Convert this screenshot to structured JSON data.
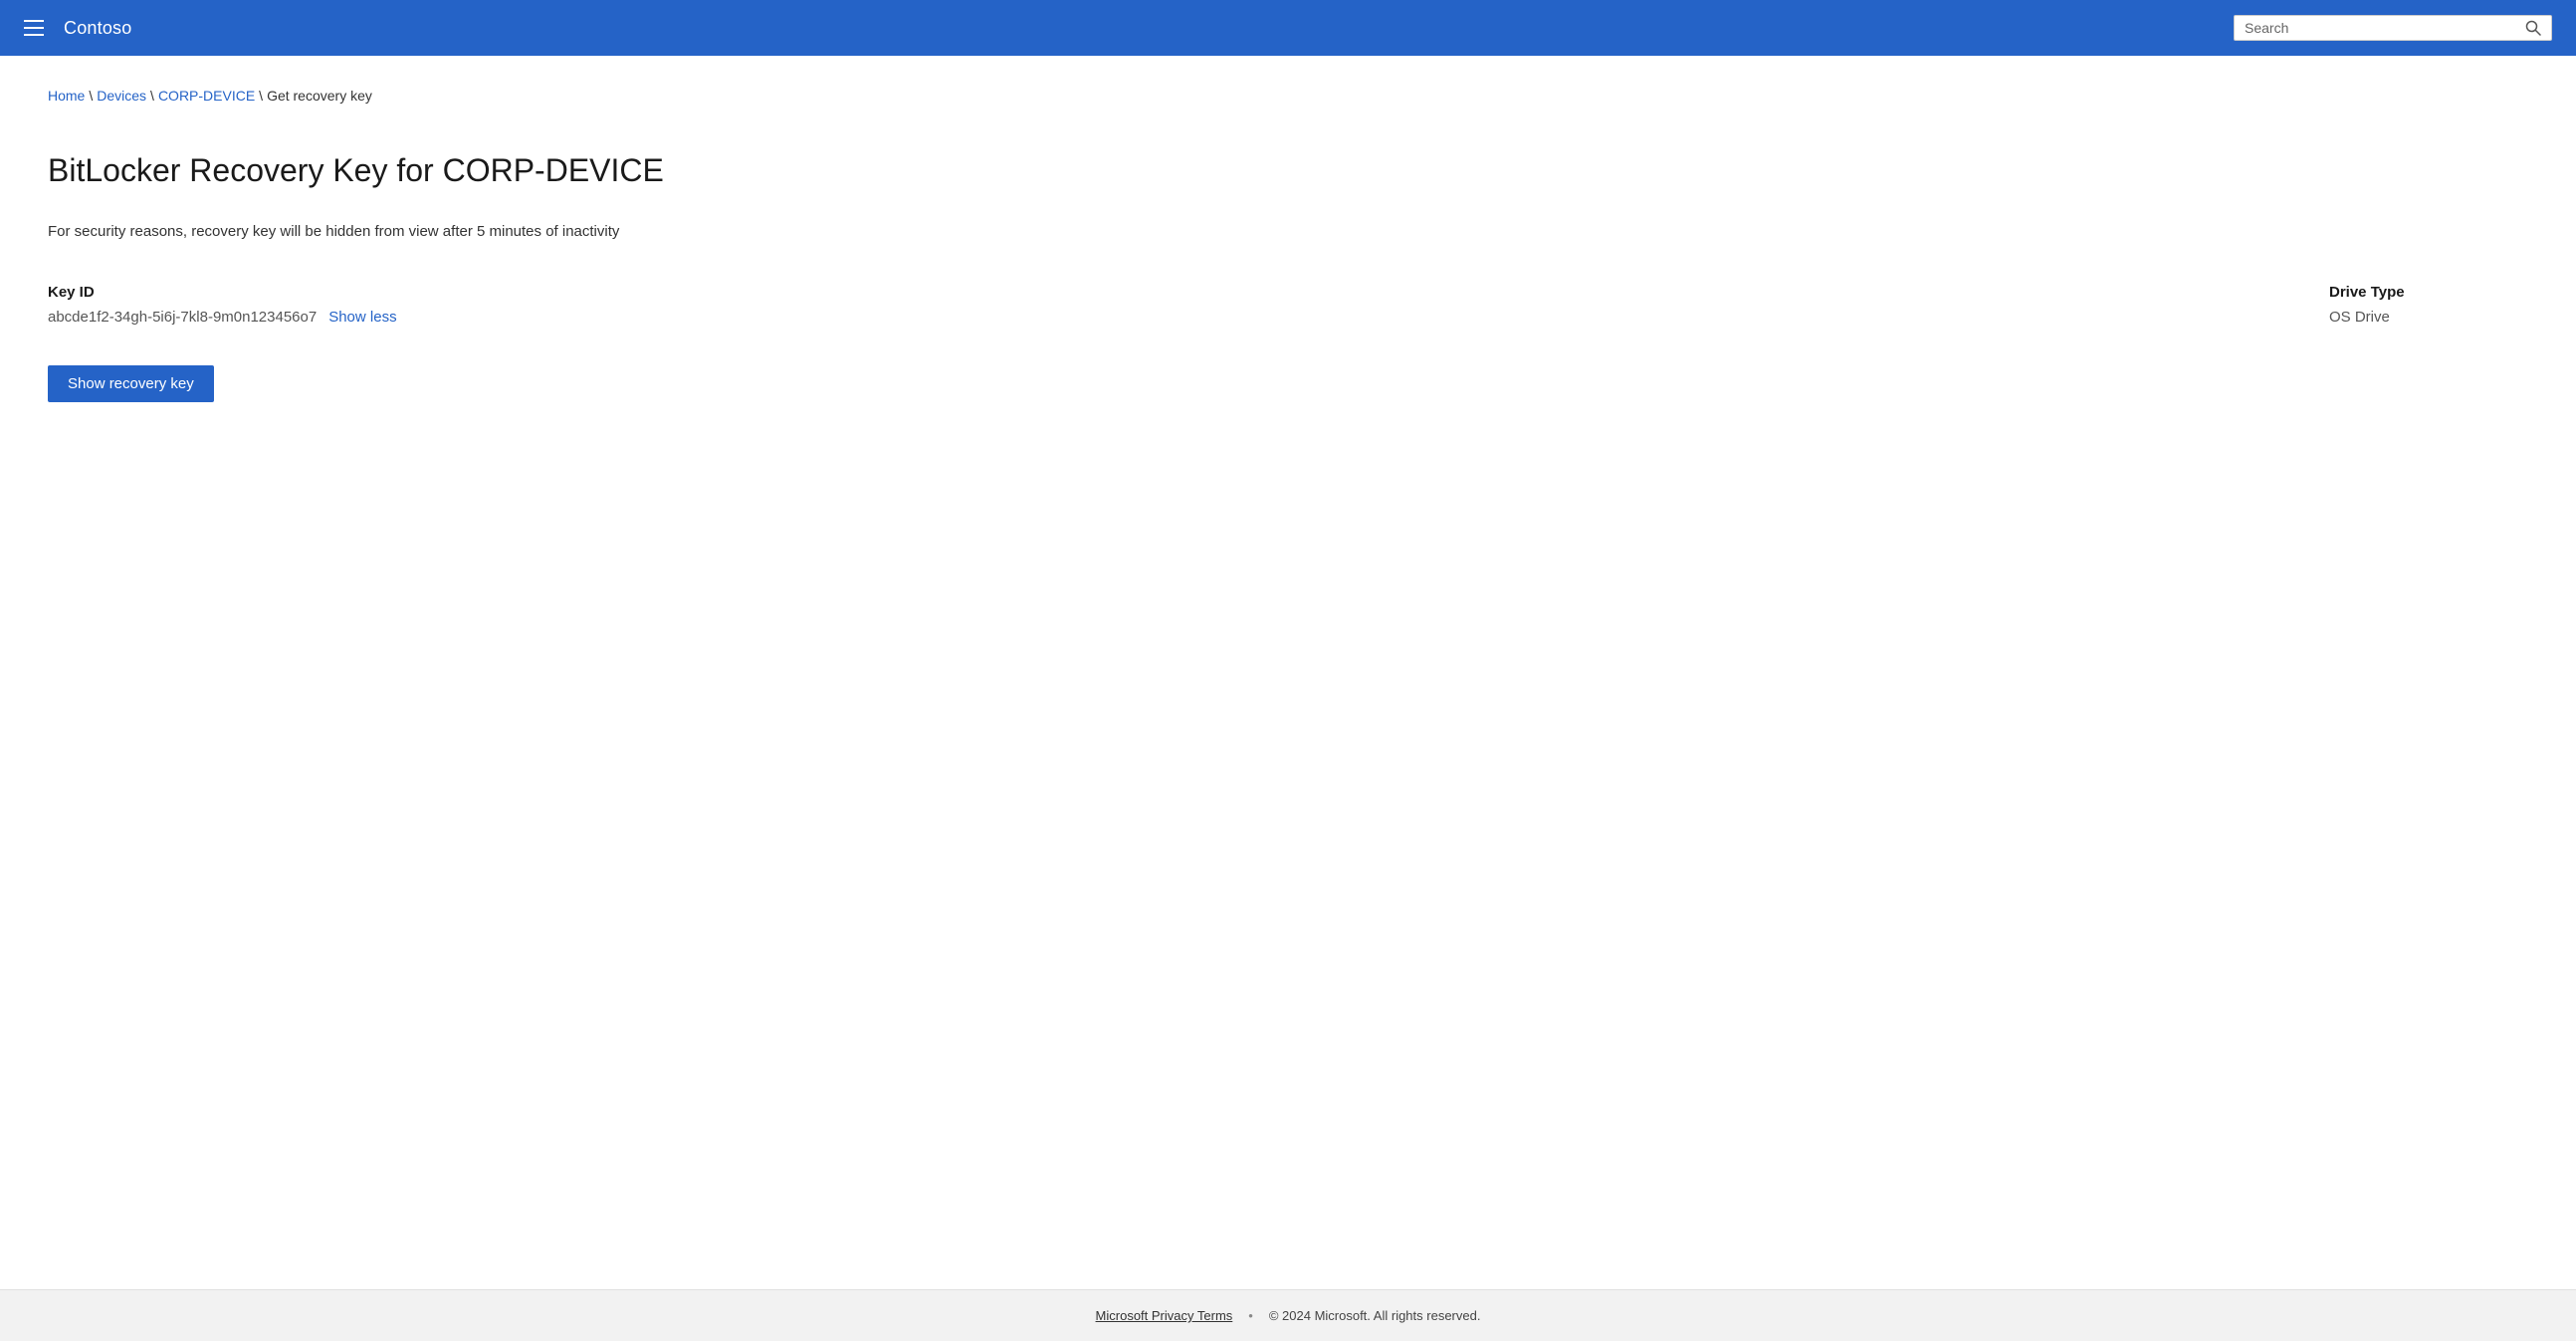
{
  "header": {
    "brand": "Contoso",
    "search_placeholder": "Search"
  },
  "breadcrumb": {
    "home": "Home",
    "devices": "Devices",
    "device": "CORP-DEVICE",
    "current": "Get recovery key",
    "separator": "\\"
  },
  "page": {
    "title": "BitLocker Recovery Key for CORP-DEVICE",
    "security_notice": "For security reasons, recovery key will be hidden from view after 5 minutes of inactivity"
  },
  "key_info": {
    "key_id_label": "Key ID",
    "key_id_value": "abcde1f2-34gh-5i6j-7kl8-9m0n123456o7",
    "show_less_label": "Show less",
    "drive_type_label": "Drive Type",
    "drive_type_value": "OS Drive"
  },
  "buttons": {
    "show_recovery_key": "Show recovery key"
  },
  "footer": {
    "privacy_link": "Microsoft Privacy Terms",
    "copyright": "© 2024 Microsoft. All rights reserved."
  },
  "icons": {
    "hamburger": "hamburger-menu-icon",
    "search": "search-icon"
  },
  "colors": {
    "header_bg": "#2563c7",
    "link": "#2563c7",
    "button_bg": "#2563c7"
  }
}
